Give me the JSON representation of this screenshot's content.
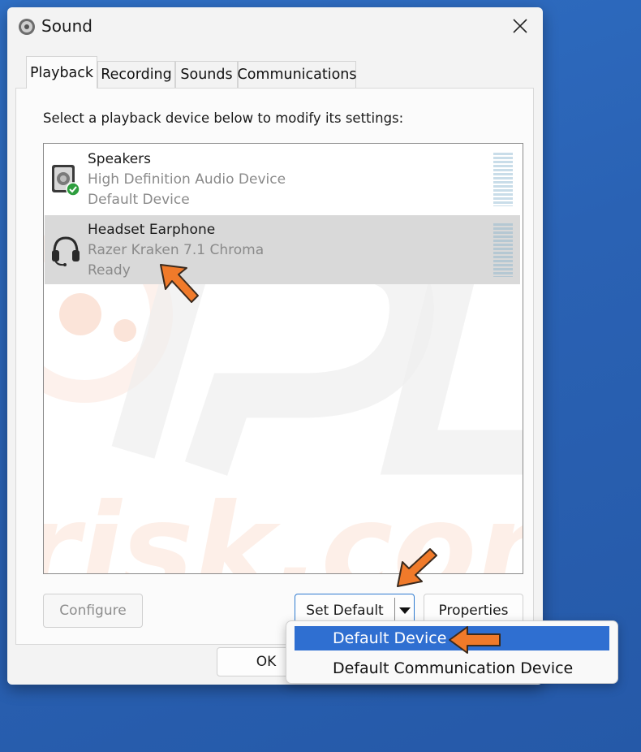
{
  "window": {
    "title": "Sound"
  },
  "tabs": [
    {
      "label": "Playback",
      "active": true
    },
    {
      "label": "Recording",
      "active": false
    },
    {
      "label": "Sounds",
      "active": false
    },
    {
      "label": "Communications",
      "active": false
    }
  ],
  "playback": {
    "instruction": "Select a playback device below to modify its settings:",
    "devices": [
      {
        "name": "Speakers",
        "description": "High Definition Audio Device",
        "status": "Default Device",
        "icon": "speaker-icon",
        "selected": false
      },
      {
        "name": "Headset Earphone",
        "description": "Razer Kraken 7.1 Chroma",
        "status": "Ready",
        "icon": "headset-icon",
        "selected": true
      }
    ]
  },
  "buttons": {
    "configure": "Configure",
    "set_default": "Set Default",
    "properties": "Properties",
    "ok": "OK"
  },
  "dropdown_menu": {
    "items": [
      {
        "label": "Default Device",
        "highlighted": true
      },
      {
        "label": "Default Communication Device",
        "highlighted": false
      }
    ]
  },
  "colors": {
    "accent": "#2f6fd1",
    "annotation_arrow": "#f07a2a",
    "default_check": "#2e9e3e"
  }
}
